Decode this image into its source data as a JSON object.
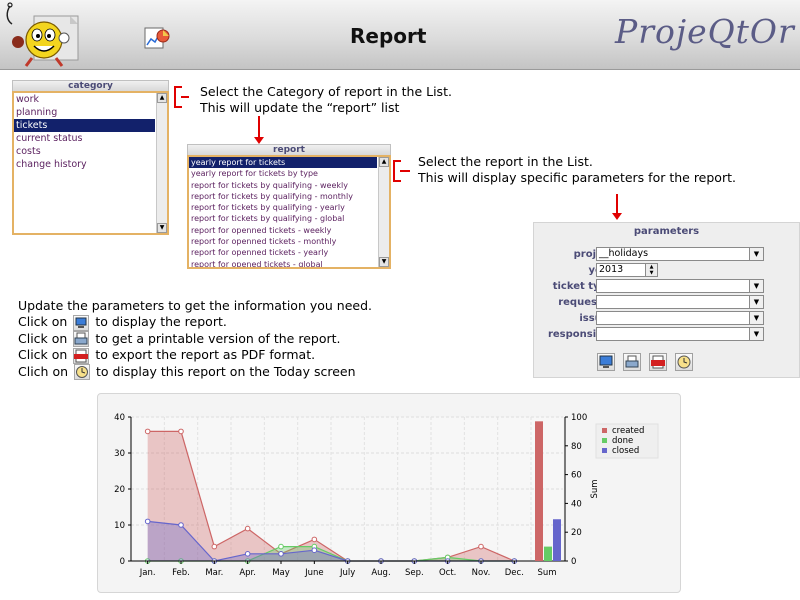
{
  "header": {
    "title": "Report",
    "brand": "ProjeQtOr"
  },
  "category_list": {
    "header": "category",
    "items": [
      "work",
      "planning",
      "tickets",
      "current status",
      "costs",
      "change history"
    ],
    "selected_index": 2
  },
  "report_list": {
    "header": "report",
    "items": [
      "yearly report for tickets",
      "yearly report for tickets by type",
      "report for tickets by qualifying - weekly",
      "report for tickets by qualifying - monthly",
      "report for tickets by qualifying - yearly",
      "report for tickets by qualifying - global",
      "report for openned tickets - weekly",
      "report for openned tickets - monthly",
      "report for openned tickets - yearly",
      "report for opened tickets - global"
    ],
    "selected_index": 0
  },
  "notes": {
    "category": [
      "Select the Category of report in the List.",
      "This will update the “report” list"
    ],
    "report": [
      "Select the report in the List.",
      "This will display specific parameters for the report."
    ],
    "instructions": {
      "line0": "Update the parameters to get the information you need.",
      "line1_pre": "Click on",
      "line1_post": "to display the report.",
      "line2_pre": "Click on",
      "line2_post": "to get a printable version of the report.",
      "line3_pre": "Click on",
      "line3_post": "to export the report as PDF format.",
      "line4_pre": "Clich on",
      "line4_post": "to display this report on the Today screen"
    }
  },
  "parameters": {
    "title": "parameters",
    "project_label": "project :",
    "project_value": "__holidays",
    "year_label": "year :",
    "year_value": "2013",
    "ticket_type_label": "ticket type :",
    "ticket_type_value": "",
    "requestor_label": "requestor :",
    "requestor_value": "",
    "issuer_label": "issuer :",
    "issuer_value": "",
    "responsible_label": "responsible :",
    "responsible_value": ""
  },
  "colors": {
    "created": "#cd6666",
    "done": "#66cc66",
    "closed": "#6666cc",
    "accent_border": "#e4b264",
    "selection": "#12216b",
    "label": "#4b4b76",
    "annotation": "#e00000"
  },
  "chart_data": {
    "type": "area",
    "categories": [
      "Jan.",
      "Feb.",
      "Mar.",
      "Apr.",
      "May",
      "June",
      "July",
      "Aug.",
      "Sep.",
      "Oct.",
      "Nov.",
      "Dec."
    ],
    "series": [
      {
        "name": "created",
        "values": [
          36,
          36,
          4,
          9,
          2,
          6,
          0,
          0,
          0,
          1,
          4,
          0
        ]
      },
      {
        "name": "done",
        "values": [
          0,
          0,
          0,
          0,
          4,
          4,
          0,
          0,
          0,
          1,
          0,
          0
        ]
      },
      {
        "name": "closed",
        "values": [
          11,
          10,
          0,
          2,
          2,
          3,
          0,
          0,
          0,
          0,
          0,
          0
        ]
      }
    ],
    "ylim": [
      0,
      40
    ],
    "yticks": [
      "0",
      "10",
      "20",
      "30",
      "40"
    ],
    "sum": {
      "label": "Sum",
      "axis_label": "Sum",
      "ylim": [
        0,
        100
      ],
      "yticks": [
        "0",
        "20",
        "40",
        "60",
        "80",
        "100"
      ],
      "values": [
        97,
        10,
        29
      ]
    },
    "legend": [
      "created",
      "done",
      "closed"
    ],
    "legend_position": "top-right",
    "grid": true
  }
}
